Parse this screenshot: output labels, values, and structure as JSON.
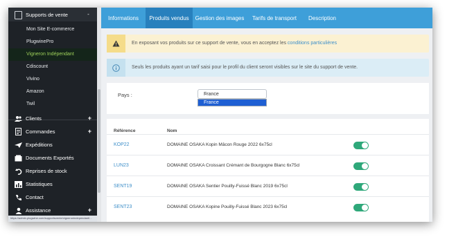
{
  "sidebar": {
    "group_label": "Supports de vente",
    "group_toggle": "-",
    "sub_items": [
      {
        "label": "Mon Site E-commerce",
        "active": false
      },
      {
        "label": "PlugwinePro",
        "active": false
      },
      {
        "label": "Vigneron Indépendant",
        "active": true
      },
      {
        "label": "Cdiscount",
        "active": false
      },
      {
        "label": "Vivino",
        "active": false
      },
      {
        "label": "Amazon",
        "active": false
      },
      {
        "label": "Twil",
        "active": false
      }
    ],
    "menu_items": [
      {
        "label": "Clients",
        "icon": "users-icon",
        "expand": "+"
      },
      {
        "label": "Commandes",
        "icon": "orders-icon",
        "expand": "+"
      },
      {
        "label": "Expéditions",
        "icon": "plane-icon",
        "expand": ""
      },
      {
        "label": "Documents Exportés",
        "icon": "documents-icon",
        "expand": ""
      },
      {
        "label": "Reprises de stock",
        "icon": "undo-icon",
        "expand": ""
      },
      {
        "label": "Statistiques",
        "icon": "chart-icon",
        "expand": ""
      },
      {
        "label": "Contact",
        "icon": "phone-icon",
        "expand": ""
      },
      {
        "label": "Assistance",
        "icon": "user-icon",
        "expand": "+"
      }
    ],
    "status_url": "https://admin.plugwine.com/supportsvente/vigneronindependant/..."
  },
  "tabs": [
    {
      "label": "Informations",
      "active": false
    },
    {
      "label": "Produits vendus",
      "active": true
    },
    {
      "label": "Gestion des images",
      "active": false
    },
    {
      "label": "Tarifs de transport",
      "active": false
    },
    {
      "label": "Description",
      "active": false
    }
  ],
  "alerts": {
    "warning_text": "En exposant vos produits sur ce support de vente, vous en acceptez les ",
    "warning_link": "conditions particulières",
    "info_text": "Seuls les produits ayant un tarif saisi pour le profil du client seront visibles sur le site du support de vente."
  },
  "filter": {
    "pays_label": "Pays :",
    "selected": "France",
    "options": [
      "France"
    ]
  },
  "table": {
    "headers": {
      "ref": "Référence",
      "nom": "Nom"
    },
    "rows": [
      {
        "ref": "KOP22",
        "nom": "DOMAINE OSAKA Kopin Mâcon Rouge 2022 6x75cl",
        "enabled": true
      },
      {
        "ref": "LUN23",
        "nom": "DOMAINE OSAKA Croissant Crémant de Bourgogne Blanc 6x75cl",
        "enabled": true
      },
      {
        "ref": "SENT19",
        "nom": "DOMAINE OSAKA Sentier Pouilly-Fuissé Blanc 2019 6x75cl",
        "enabled": true
      },
      {
        "ref": "SENT23",
        "nom": "DOMAINE OSAKA Kopine Pouilly-Fuissé Blanc 2023 6x75cl",
        "enabled": true
      }
    ]
  },
  "colors": {
    "sidebar_bg": "#1e2227",
    "tabbar_bg": "#3e9fd9",
    "active_tab_bg": "#2880bd",
    "active_item": "#9ed05a",
    "link": "#3e8fc9",
    "toggle_on": "#2fa87a"
  }
}
